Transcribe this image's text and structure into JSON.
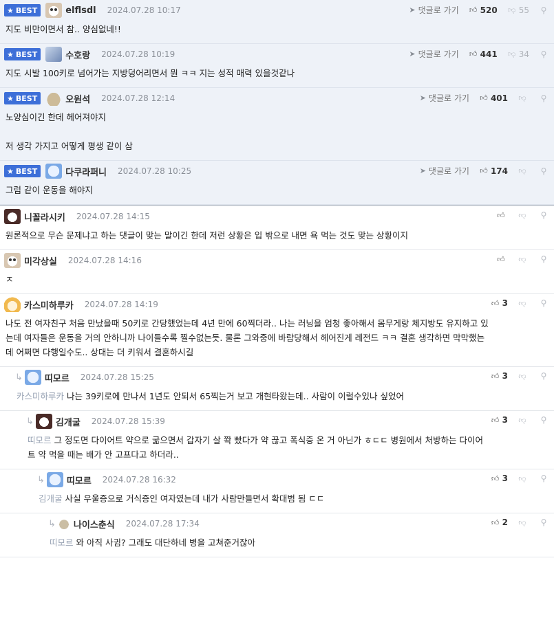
{
  "labels": {
    "best": "BEST",
    "reply": "댓글로 가기"
  },
  "comments": [
    {
      "best": true,
      "nick": "elflsdl",
      "date": "2024.07.28 10:17",
      "up": "520",
      "down": "55",
      "avatar": "dog",
      "lines": [
        "지도 비만이면서 참.. 양심없네!!"
      ]
    },
    {
      "best": true,
      "nick": "수호랑",
      "date": "2024.07.28 10:19",
      "up": "441",
      "down": "34",
      "avatar": "wolf",
      "lines": [
        "지도 시발 100키로 넘어가는 지방덩어리면서 뭔 ㅋㅋ 지는 성적 매력 있을것같나"
      ]
    },
    {
      "best": true,
      "nick": "오원석",
      "date": "2024.07.28 12:14",
      "up": "401",
      "down": "",
      "avatar": "blob",
      "lines": [
        "노양심이긴 한데 헤어져야지",
        "",
        "저 생각 가지고 어떻게 평생 같이 삼"
      ]
    },
    {
      "best": true,
      "nick": "다쿠라퍼니",
      "date": "2024.07.28 10:25",
      "up": "174",
      "down": "",
      "avatar": "ghost",
      "lines": [
        "그럼 같이 운동을 해야지"
      ]
    },
    {
      "best": false,
      "nick": "니꼴라시키",
      "date": "2024.07.28 14:15",
      "up": "",
      "avatar": "panda",
      "lines": [
        "원론적으로 무슨 문제냐고 하는 댓글이 맞는 말이긴 한데 저런 상황은 입 밖으로 내면 욕 먹는 것도 맞는 상황이지"
      ]
    },
    {
      "best": false,
      "nick": "미각상실",
      "date": "2024.07.28 14:16",
      "up": "",
      "avatar": "dog",
      "lines": [
        "ㅈ"
      ]
    },
    {
      "best": false,
      "nick": "카스미하루카",
      "date": "2024.07.28 14:19",
      "up": "3",
      "avatar": "fox",
      "lines": [
        "나도 전 여자친구 처음 만났을때 50키로 간당했었는데 4년 만에 60찍더라.. 나는 러닝을 엄청 좋아해서 몸무게랑 체지방도 유지하고 있",
        "는데 여자들은 운동을 거의 안하니까 나이들수록 찔수없는듯. 물론 그와중에 바람당해서 헤어진게 레전드 ㅋㅋ 결혼 생각하면 막막했는",
        "데 어쩌면 다행일수도.. 상대는 더 키워서 결혼하시길"
      ]
    },
    {
      "best": false,
      "depth": 1,
      "nick": "띠모르",
      "date": "2024.07.28 15:25",
      "up": "3",
      "avatar": "ghost",
      "mention": "카스미하루카",
      "lines": [
        "나는 39키로에 만나서 1년도 안되서 65찍는거 보고 개현타왔는데.. 사람이 이럴수있나 싶었어"
      ]
    },
    {
      "best": false,
      "depth": 2,
      "nick": "김개굴",
      "date": "2024.07.28 15:39",
      "up": "3",
      "avatar": "panda",
      "mention": "띠모르",
      "lines": [
        "그 정도면 다이어트 약으로 굶으면서 갑자기 살 쫙 빴다가 약 끊고 폭식증 온 거 아닌가 ㅎㄷㄷ 병원에서 처방하는 다이어",
        "트 약 먹을 때는 배가 안 고프다고 하더라.."
      ]
    },
    {
      "best": false,
      "depth": 3,
      "nick": "띠모르",
      "date": "2024.07.28 16:32",
      "up": "3",
      "avatar": "ghost",
      "mention": "김개굴",
      "lines": [
        "사실 우울증으로 거식증인 여자였는데 내가 사람만들면서 확대범 됨 ㄷㄷ"
      ]
    },
    {
      "best": false,
      "depth": 4,
      "nick": "나이스춘식",
      "date": "2024.07.28 17:34",
      "up": "2",
      "avatar": "dot",
      "mention": "띠모르",
      "lines": [
        "와 아직 사귐? 그래도 대단하네 병을 고쳐준거잖아"
      ]
    }
  ]
}
